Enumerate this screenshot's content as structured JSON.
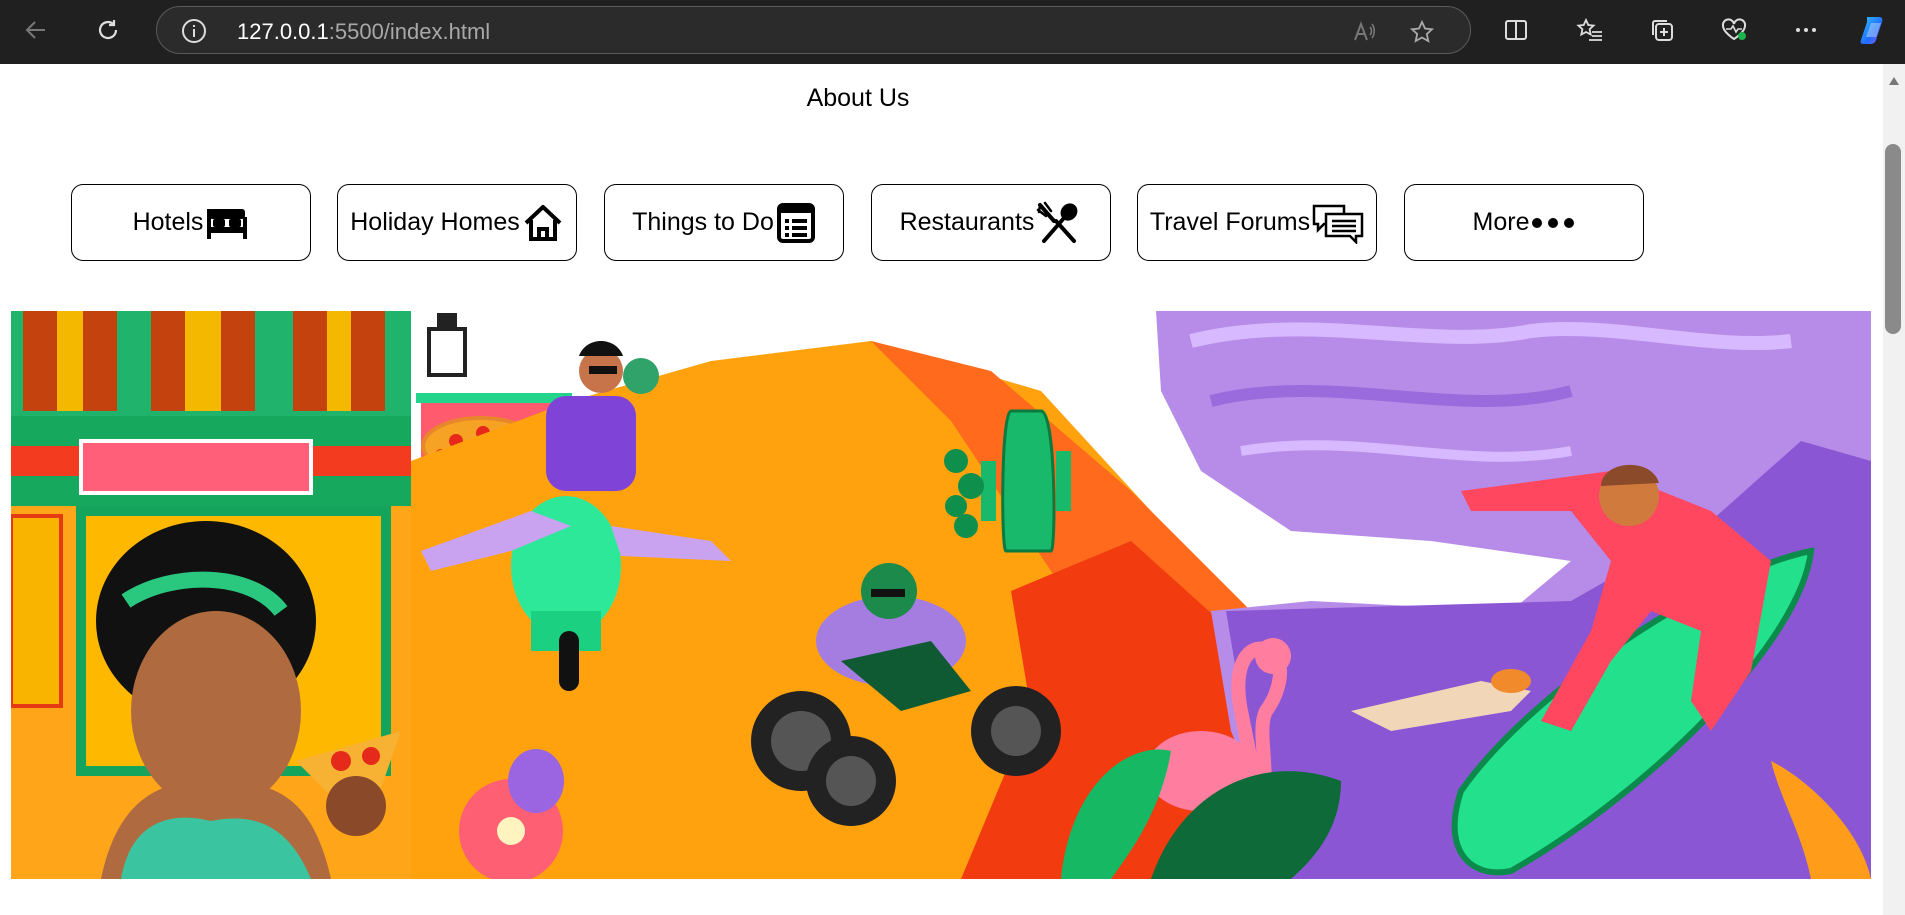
{
  "browser": {
    "url_host": "127.0.0.1",
    "url_rest": ":5500/index.html"
  },
  "page": {
    "heading": "About Us",
    "nav_buttons": [
      {
        "label": "Hotels",
        "icon": "bed-icon"
      },
      {
        "label": "Holiday Homes",
        "icon": "house-icon"
      },
      {
        "label": "Things to Do",
        "icon": "list-icon"
      },
      {
        "label": "Restaurants",
        "icon": "fork-spoon-icon"
      },
      {
        "label": "Travel Forums",
        "icon": "chat-bubbles-icon"
      },
      {
        "label": "More",
        "icon": "three-dots-icon"
      }
    ]
  }
}
